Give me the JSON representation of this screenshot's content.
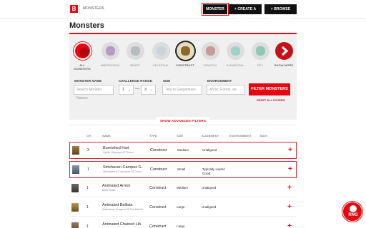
{
  "topbar": {
    "logo": "B",
    "breadcrumb": "MONSTERS",
    "buttons": [
      "MONSTER RULES",
      "+ CREATE A MONSTER",
      "+ BROWSE HOMEBREW"
    ]
  },
  "page": {
    "title": "Monsters"
  },
  "categories": [
    {
      "label": "ALL MONSTERS",
      "color": "#e40712"
    },
    {
      "label": "ABERRATION",
      "color": "#b59cc0"
    },
    {
      "label": "BEAST",
      "color": "#b8bcc0"
    },
    {
      "label": "CELESTIAL",
      "color": "#c8d6da"
    },
    {
      "label": "CONSTRUCT",
      "color": "#c2a04a"
    },
    {
      "label": "DRAGON",
      "color": "#c89a98"
    },
    {
      "label": "ELEMENTAL",
      "color": "#9ed0cc"
    },
    {
      "label": "FEY",
      "color": "#8fc8b4"
    },
    {
      "label": "SHOW MORE",
      "color": "#c5121a"
    }
  ],
  "filters": {
    "name_label": "MONSTER NAME",
    "name_placeholder": "Search Monster Names",
    "cr_label": "CHALLENGE RANGE",
    "cr_min": "1",
    "cr_max": "3",
    "size_label": "SIZE",
    "size_placeholder": "Tiny to Gargantuan",
    "env_label": "ENVIRONMENT",
    "env_placeholder": "Arctic, Forest, etc.",
    "filter_button": "FILTER MONSTERS",
    "reset": "RESET ALL FILTERS",
    "advanced": "SHOW ADVANCED FILTERS"
  },
  "table": {
    "headers": [
      "CR",
      "NAME",
      "TYPE",
      "SIZE",
      "ALIGNMENT",
      "ENVIRONMENT",
      "TAGS"
    ],
    "rows": [
      {
        "cr": "3",
        "name": "Burnished Hart",
        "source": "Mythic Odysseys Of Theros",
        "type": "Construct",
        "size": "Medium",
        "alignment": "Unaligned",
        "highlight": true
      },
      {
        "cr": "1",
        "name": "Strixhaven Campus G...",
        "source": "Strixhaven: A Curriculum Of Chaos",
        "type": "Construct",
        "size": "Small",
        "alignment": "Typically Lawful Good",
        "highlight": true
      },
      {
        "cr": "1",
        "name": "Animated Armor",
        "source": "Basic Rules",
        "type": "Construct",
        "size": "Medium",
        "alignment": "Unaligned",
        "highlight": false
      },
      {
        "cr": "1",
        "name": "Animated Ballista",
        "source": "Waterdeep: Dungeon Of The Mad M...",
        "type": "Construct",
        "size": "Large",
        "alignment": "Unaligned",
        "highlight": false
      },
      {
        "cr": "1",
        "name": "Animated Chained Lib...",
        "source": "",
        "type": "Construct",
        "size": "Large",
        "alignment": "",
        "highlight": false
      }
    ]
  },
  "badge": {
    "text": "RNG"
  }
}
